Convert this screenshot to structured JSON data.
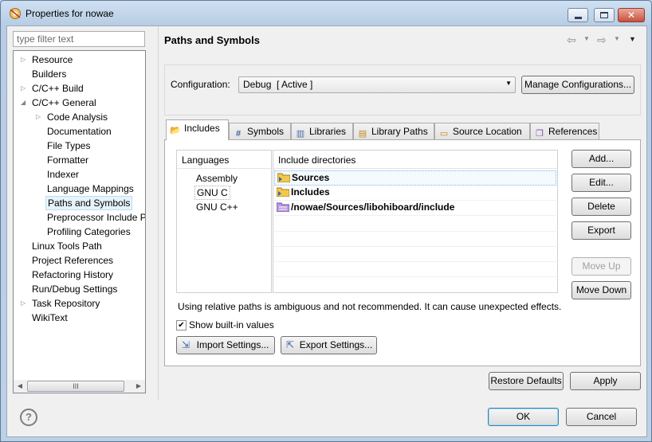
{
  "window": {
    "title": "Properties for nowae"
  },
  "filter": {
    "placeholder": "type filter text"
  },
  "tree": {
    "items": [
      {
        "label": "Resource",
        "expander": "collapsed"
      },
      {
        "label": "Builders",
        "expander": "none"
      },
      {
        "label": "C/C++ Build",
        "expander": "collapsed"
      },
      {
        "label": "C/C++ General",
        "expander": "expanded"
      },
      {
        "label": "Code Analysis",
        "expander": "collapsed"
      },
      {
        "label": "Documentation",
        "expander": "none"
      },
      {
        "label": "File Types",
        "expander": "none"
      },
      {
        "label": "Formatter",
        "expander": "none"
      },
      {
        "label": "Indexer",
        "expander": "none"
      },
      {
        "label": "Language Mappings",
        "expander": "none"
      },
      {
        "label": "Paths and Symbols",
        "expander": "none",
        "selected": true
      },
      {
        "label": "Preprocessor Include Pa",
        "expander": "none"
      },
      {
        "label": "Profiling Categories",
        "expander": "none"
      },
      {
        "label": "Linux Tools Path",
        "expander": "none"
      },
      {
        "label": "Project References",
        "expander": "none"
      },
      {
        "label": "Refactoring History",
        "expander": "none"
      },
      {
        "label": "Run/Debug Settings",
        "expander": "none"
      },
      {
        "label": "Task Repository",
        "expander": "collapsed"
      },
      {
        "label": "WikiText",
        "expander": "none"
      }
    ],
    "scroll_thumb": "III"
  },
  "page": {
    "title": "Paths and Symbols",
    "configuration_label": "Configuration:",
    "configuration_value": "Debug  [ Active ]",
    "manage_button": "Manage Configurations..."
  },
  "tabs": [
    {
      "label": "Includes",
      "icon": "includes-icon",
      "active": true
    },
    {
      "label": "Symbols",
      "icon": "hash-icon"
    },
    {
      "label": "Libraries",
      "icon": "library-icon"
    },
    {
      "label": "Library Paths",
      "icon": "library-path-icon"
    },
    {
      "label": "Source Location",
      "icon": "folder-icon"
    },
    {
      "label": "References",
      "icon": "references-icon"
    }
  ],
  "languages": {
    "header": "Languages",
    "items": [
      "Assembly",
      "GNU C",
      "GNU C++"
    ],
    "selected": "GNU C"
  },
  "include_dirs": {
    "header": "Include directories",
    "rows": [
      {
        "label": "Sources",
        "icon": "folder-include-icon"
      },
      {
        "label": "Includes",
        "icon": "folder-include-icon"
      },
      {
        "label": "/nowae/Sources/libohiboard/include",
        "icon": "workspace-folder-icon"
      }
    ]
  },
  "side_buttons": {
    "add": "Add...",
    "edit": "Edit...",
    "delete": "Delete",
    "export": "Export",
    "move_up": "Move Up",
    "move_down": "Move Down"
  },
  "warning": "Using relative paths is ambiguous and not recommended. It can cause unexpected effects.",
  "show_builtin": {
    "label": "Show built-in values",
    "checked": true
  },
  "import_settings": "Import Settings...",
  "export_settings": "Export Settings...",
  "footer": {
    "restore_defaults": "Restore Defaults",
    "apply": "Apply",
    "ok": "OK",
    "cancel": "Cancel"
  },
  "colors": {
    "selection": "#e5f3fb",
    "title_bg": "#bcd0e6",
    "close": "#c8503a"
  }
}
